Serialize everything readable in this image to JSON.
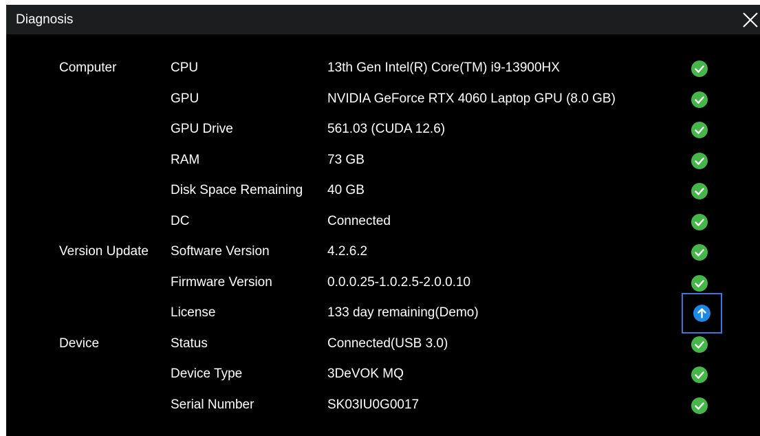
{
  "window": {
    "title": "Diagnosis",
    "close_icon": "close-icon"
  },
  "colors": {
    "ok": "#46b64a",
    "update": "#1e88e5",
    "highlight_border": "#3d78d8"
  },
  "rows": [
    {
      "category": "Computer",
      "key": "CPU",
      "value": "13th Gen Intel(R) Core(TM) i9-13900HX",
      "status": "ok"
    },
    {
      "category": "",
      "key": "GPU",
      "value": "NVIDIA GeForce RTX 4060 Laptop GPU (8.0 GB)",
      "status": "ok"
    },
    {
      "category": "",
      "key": "GPU Drive",
      "value": "561.03 (CUDA 12.6)",
      "status": "ok"
    },
    {
      "category": "",
      "key": "RAM",
      "value": "73 GB",
      "status": "ok"
    },
    {
      "category": "",
      "key": "Disk Space Remaining",
      "value": "40 GB",
      "status": "ok"
    },
    {
      "category": "",
      "key": "DC",
      "value": "Connected",
      "status": "ok"
    },
    {
      "category": "Version Update",
      "key": "Software Version",
      "value": "4.2.6.2",
      "status": "ok"
    },
    {
      "category": "",
      "key": "Firmware Version",
      "value": "0.0.0.25-1.0.2.5-2.0.0.10",
      "status": "ok"
    },
    {
      "category": "",
      "key": "License",
      "value": "133 day remaining(Demo)",
      "status": "update"
    },
    {
      "category": "Device",
      "key": "Status",
      "value": "Connected(USB 3.0)",
      "status": "ok"
    },
    {
      "category": "",
      "key": "Device Type",
      "value": "3DeVOK MQ",
      "status": "ok"
    },
    {
      "category": "",
      "key": "Serial Number",
      "value": "SK03IU0G0017",
      "status": "ok"
    }
  ]
}
